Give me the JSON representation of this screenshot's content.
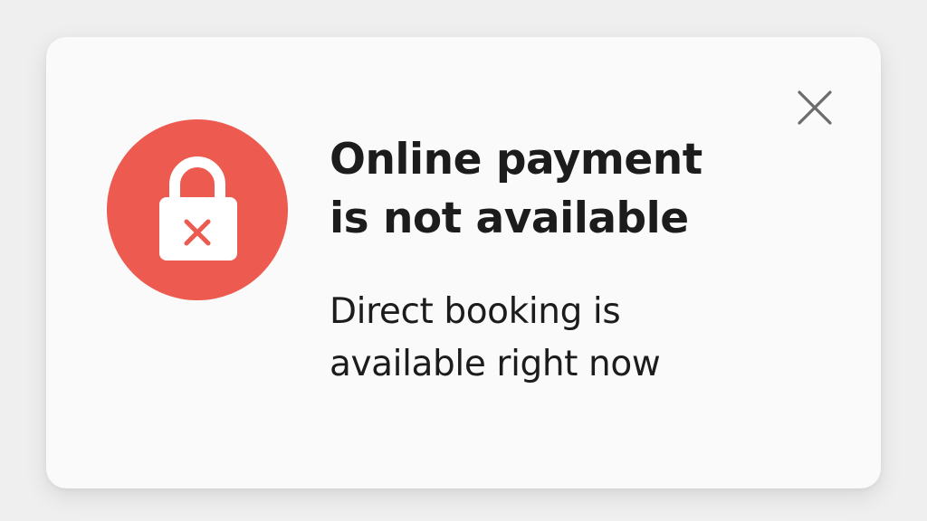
{
  "dialog": {
    "title_lines": [
      "Online payment",
      "is not available"
    ],
    "message_lines": [
      "Direct booking is",
      "available right now"
    ],
    "status_icon": "lock-with-x-icon",
    "close_icon": "close-icon"
  },
  "colors": {
    "background": "#efefef",
    "card": "#fafafa",
    "accent_red": "#ed5a4f",
    "text": "#1c1c1c",
    "close_icon": "#6b6b6b"
  }
}
